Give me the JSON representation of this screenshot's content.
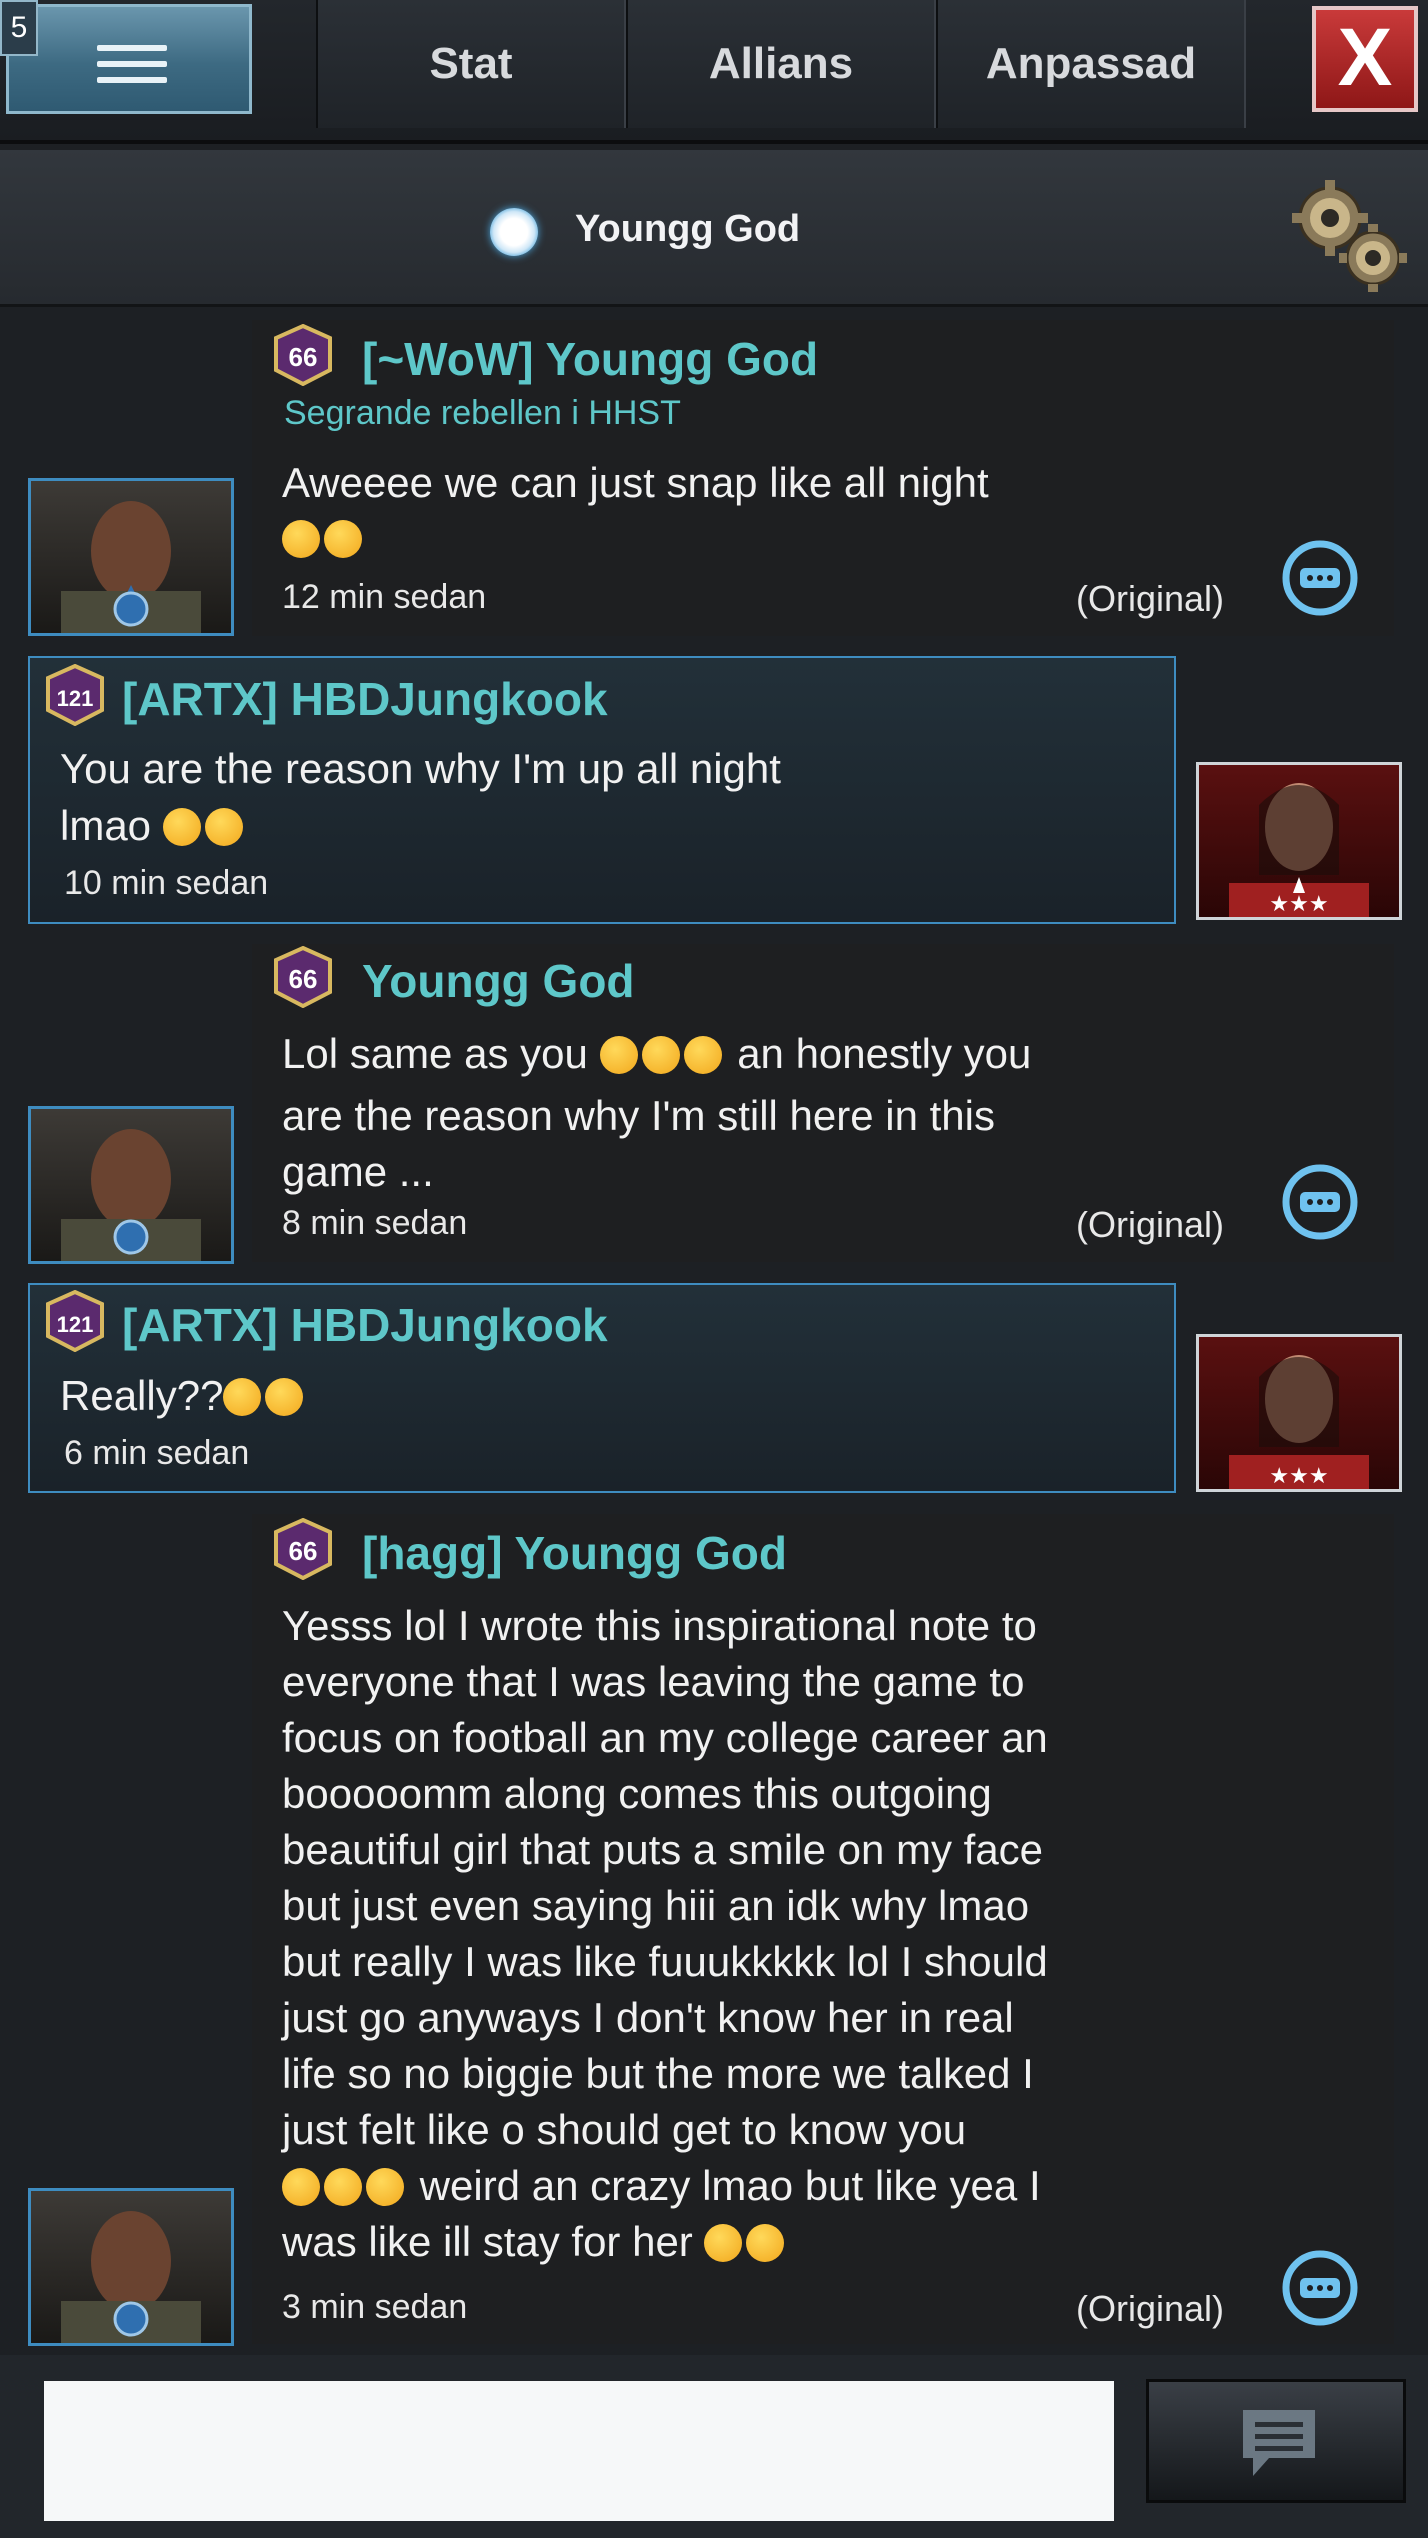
{
  "topbar": {
    "badge": "5",
    "tabs": [
      "Stat",
      "Allians",
      "Anpassad"
    ],
    "close_label": "X"
  },
  "header": {
    "channel_name": "Youngg God"
  },
  "messages": [
    {
      "rank": "66",
      "name": "[~WoW] Youngg God",
      "subtitle": "Segrande rebellen i HHST",
      "text": "Aweeee we can just snap like all night",
      "time": "12 min sedan",
      "original": "(Original)"
    },
    {
      "rank": "121",
      "name": "[ARTX] HBDJungkook",
      "text1": "You are the reason why I'm up all night",
      "text2": "lmao",
      "time": "10 min sedan"
    },
    {
      "rank": "66",
      "name": "Youngg God",
      "text1": "Lol same as you",
      "text1b": "an honestly you",
      "text2": "are the reason why I'm still here in this",
      "text3": "game ...",
      "time": "8 min sedan",
      "original": "(Original)"
    },
    {
      "rank": "121",
      "name": "[ARTX] HBDJungkook",
      "text": "Really??",
      "time": "6 min sedan"
    },
    {
      "rank": "66",
      "name": "[hagg] Youngg God",
      "lines": [
        "Yesss lol I wrote this inspirational note to",
        "everyone that I was leaving the game to",
        "focus on football an my college career an",
        "booooomm along comes this outgoing",
        "beautiful girl that puts a smile on my face",
        "but just even saying hiii an idk why lmao",
        "but really I was like fuuukkkkk lol I should",
        "just go anyways I don't know her in real",
        "life so no biggie but the more we talked I",
        "just felt like o should get to know you"
      ],
      "line11": "weird an crazy lmao but like yea I",
      "line12": "was like ill stay for her",
      "time": "3 min sedan",
      "original": "(Original)"
    }
  ],
  "colors": {
    "accent": "#5ec7c9",
    "border": "#3e8cc0",
    "close": "#b52626"
  },
  "icons": [
    "menu-icon",
    "gear-icon",
    "translate-icon",
    "chat-icon",
    "rank-badge-icon",
    "emoji-icon"
  ]
}
